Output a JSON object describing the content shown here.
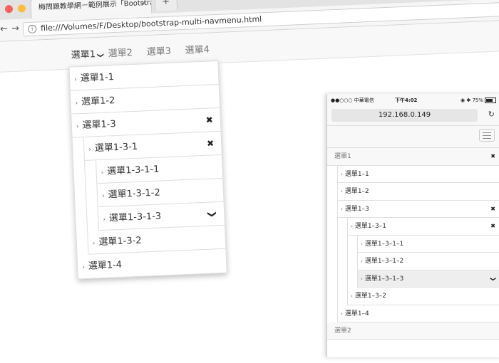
{
  "browser": {
    "tab_title": "梅問題教學網－範例展示「Bootstra",
    "tab_close": "×",
    "new_tab": "+",
    "back": "←",
    "forward": "→",
    "info": "i",
    "url": "file:///Volumes/F/Desktop/bootstrap-multi-navmenu.html",
    "colors": {
      "close": "#fc605c",
      "minimize": "#fdbc40",
      "zoom": "#34c84a"
    }
  },
  "desktop_nav": [
    {
      "label": "選單1",
      "caret": "❯"
    },
    {
      "label": "選單2"
    },
    {
      "label": "選單3"
    },
    {
      "label": "選單4"
    }
  ],
  "desktop_menu": {
    "chev": "›",
    "close_mark": "✖",
    "down_mark": "❯",
    "l1_1": "選單1-1",
    "l1_2": "選單1-2",
    "l1_3": "選單1-3",
    "l2_1": "選單1-3-1",
    "l3_1": "選單1-3-1-1",
    "l3_2": "選單1-3-1-2",
    "l3_3": "選單1-3-1-3",
    "l2_2": "選單1-3-2",
    "l1_4": "選單1-4"
  },
  "phone": {
    "carrier": "●●○○○ 中華電信",
    "time": "下午4:02",
    "battery": "75%",
    "status_icons": "◉ ✱",
    "address": "192.168.0.149",
    "reload": "↻",
    "chev": "›",
    "close_mark": "✖",
    "down_mark": "❯",
    "top1": "選單1",
    "m1_1": "選單1–1",
    "m1_2": "選單1–2",
    "m1_3": "選單1–3",
    "m1_3_1": "選單1–3–1",
    "m1_3_1_1": "選單1–3–1–1",
    "m1_3_1_2": "選單1–3–1–2",
    "m1_3_1_3": "選單1–3–1–3",
    "m1_3_2": "選單1–3–2",
    "m1_4": "選單1–4",
    "top2": "選單2"
  }
}
